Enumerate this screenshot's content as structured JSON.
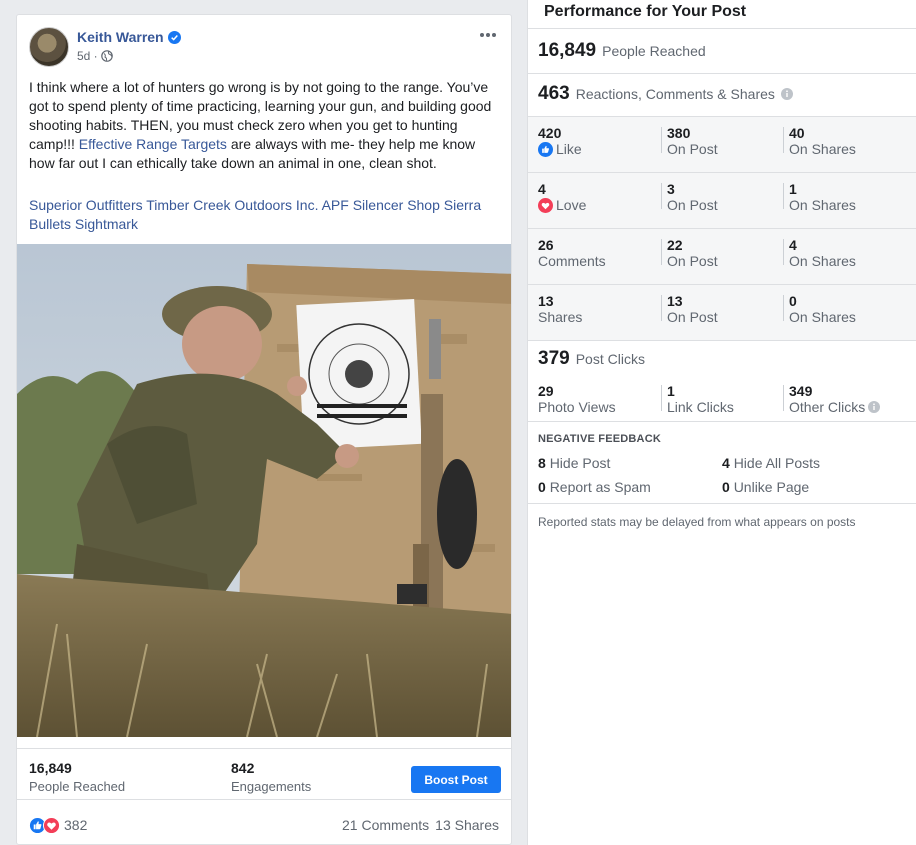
{
  "post": {
    "author": "Keith Warren",
    "time": "5d ·",
    "text_1": "I think where a lot of hunters go wrong is by not going to the range. You’ve got to spend plenty of time practicing, learning your gun, and building good shooting habits. THEN, you must check zero when you get to hunting camp!!! ",
    "text_link": "Effective Range Targets",
    "text_2": " are always with me- they help me know how far out I can ethically take down an animal in one, clean shot.",
    "tags": [
      "Superior Outfitters",
      "Timber Creek Outdoors Inc.",
      "APF",
      "Silencer Shop",
      "Sierra Bullets",
      "Sightmark"
    ],
    "stats": {
      "reach_num": "16,849",
      "reach_label": "People Reached",
      "eng_num": "842",
      "eng_label": "Engagements",
      "boost_label": "Boost Post"
    },
    "reactions": {
      "count": "382",
      "comments": "21 Comments",
      "shares": "13 Shares"
    }
  },
  "panel": {
    "title": "Performance for Your Post",
    "reached": {
      "num": "16,849",
      "label": "People Reached"
    },
    "engagement": {
      "num": "463",
      "label": "Reactions, Comments & Shares"
    },
    "grid": [
      {
        "c1_num": "420",
        "c1_label": "Like",
        "c2_num": "380",
        "c2_label": "On Post",
        "c3_num": "40",
        "c3_label": "On Shares"
      },
      {
        "c1_num": "4",
        "c1_label": "Love",
        "c2_num": "3",
        "c2_label": "On Post",
        "c3_num": "1",
        "c3_label": "On Shares"
      },
      {
        "c1_num": "26",
        "c1_label": "Comments",
        "c2_num": "22",
        "c2_label": "On Post",
        "c3_num": "4",
        "c3_label": "On Shares"
      },
      {
        "c1_num": "13",
        "c1_label": "Shares",
        "c2_num": "13",
        "c2_label": "On Post",
        "c3_num": "0",
        "c3_label": "On Shares"
      }
    ],
    "clicks": {
      "num": "379",
      "label": "Post Clicks",
      "c1_num": "29",
      "c1_label": "Photo Views",
      "c2_num": "1",
      "c2_label": "Link Clicks",
      "c3_num": "349",
      "c3_label": "Other Clicks"
    },
    "negative": {
      "header": "NEGATIVE FEEDBACK",
      "hide_post_num": "8",
      "hide_post_label": "Hide Post",
      "hide_all_num": "4",
      "hide_all_label": "Hide All Posts",
      "spam_num": "0",
      "spam_label": "Report as Spam",
      "unlike_num": "0",
      "unlike_label": "Unlike Page"
    },
    "footnote": "Reported stats may be delayed from what appears on posts"
  }
}
